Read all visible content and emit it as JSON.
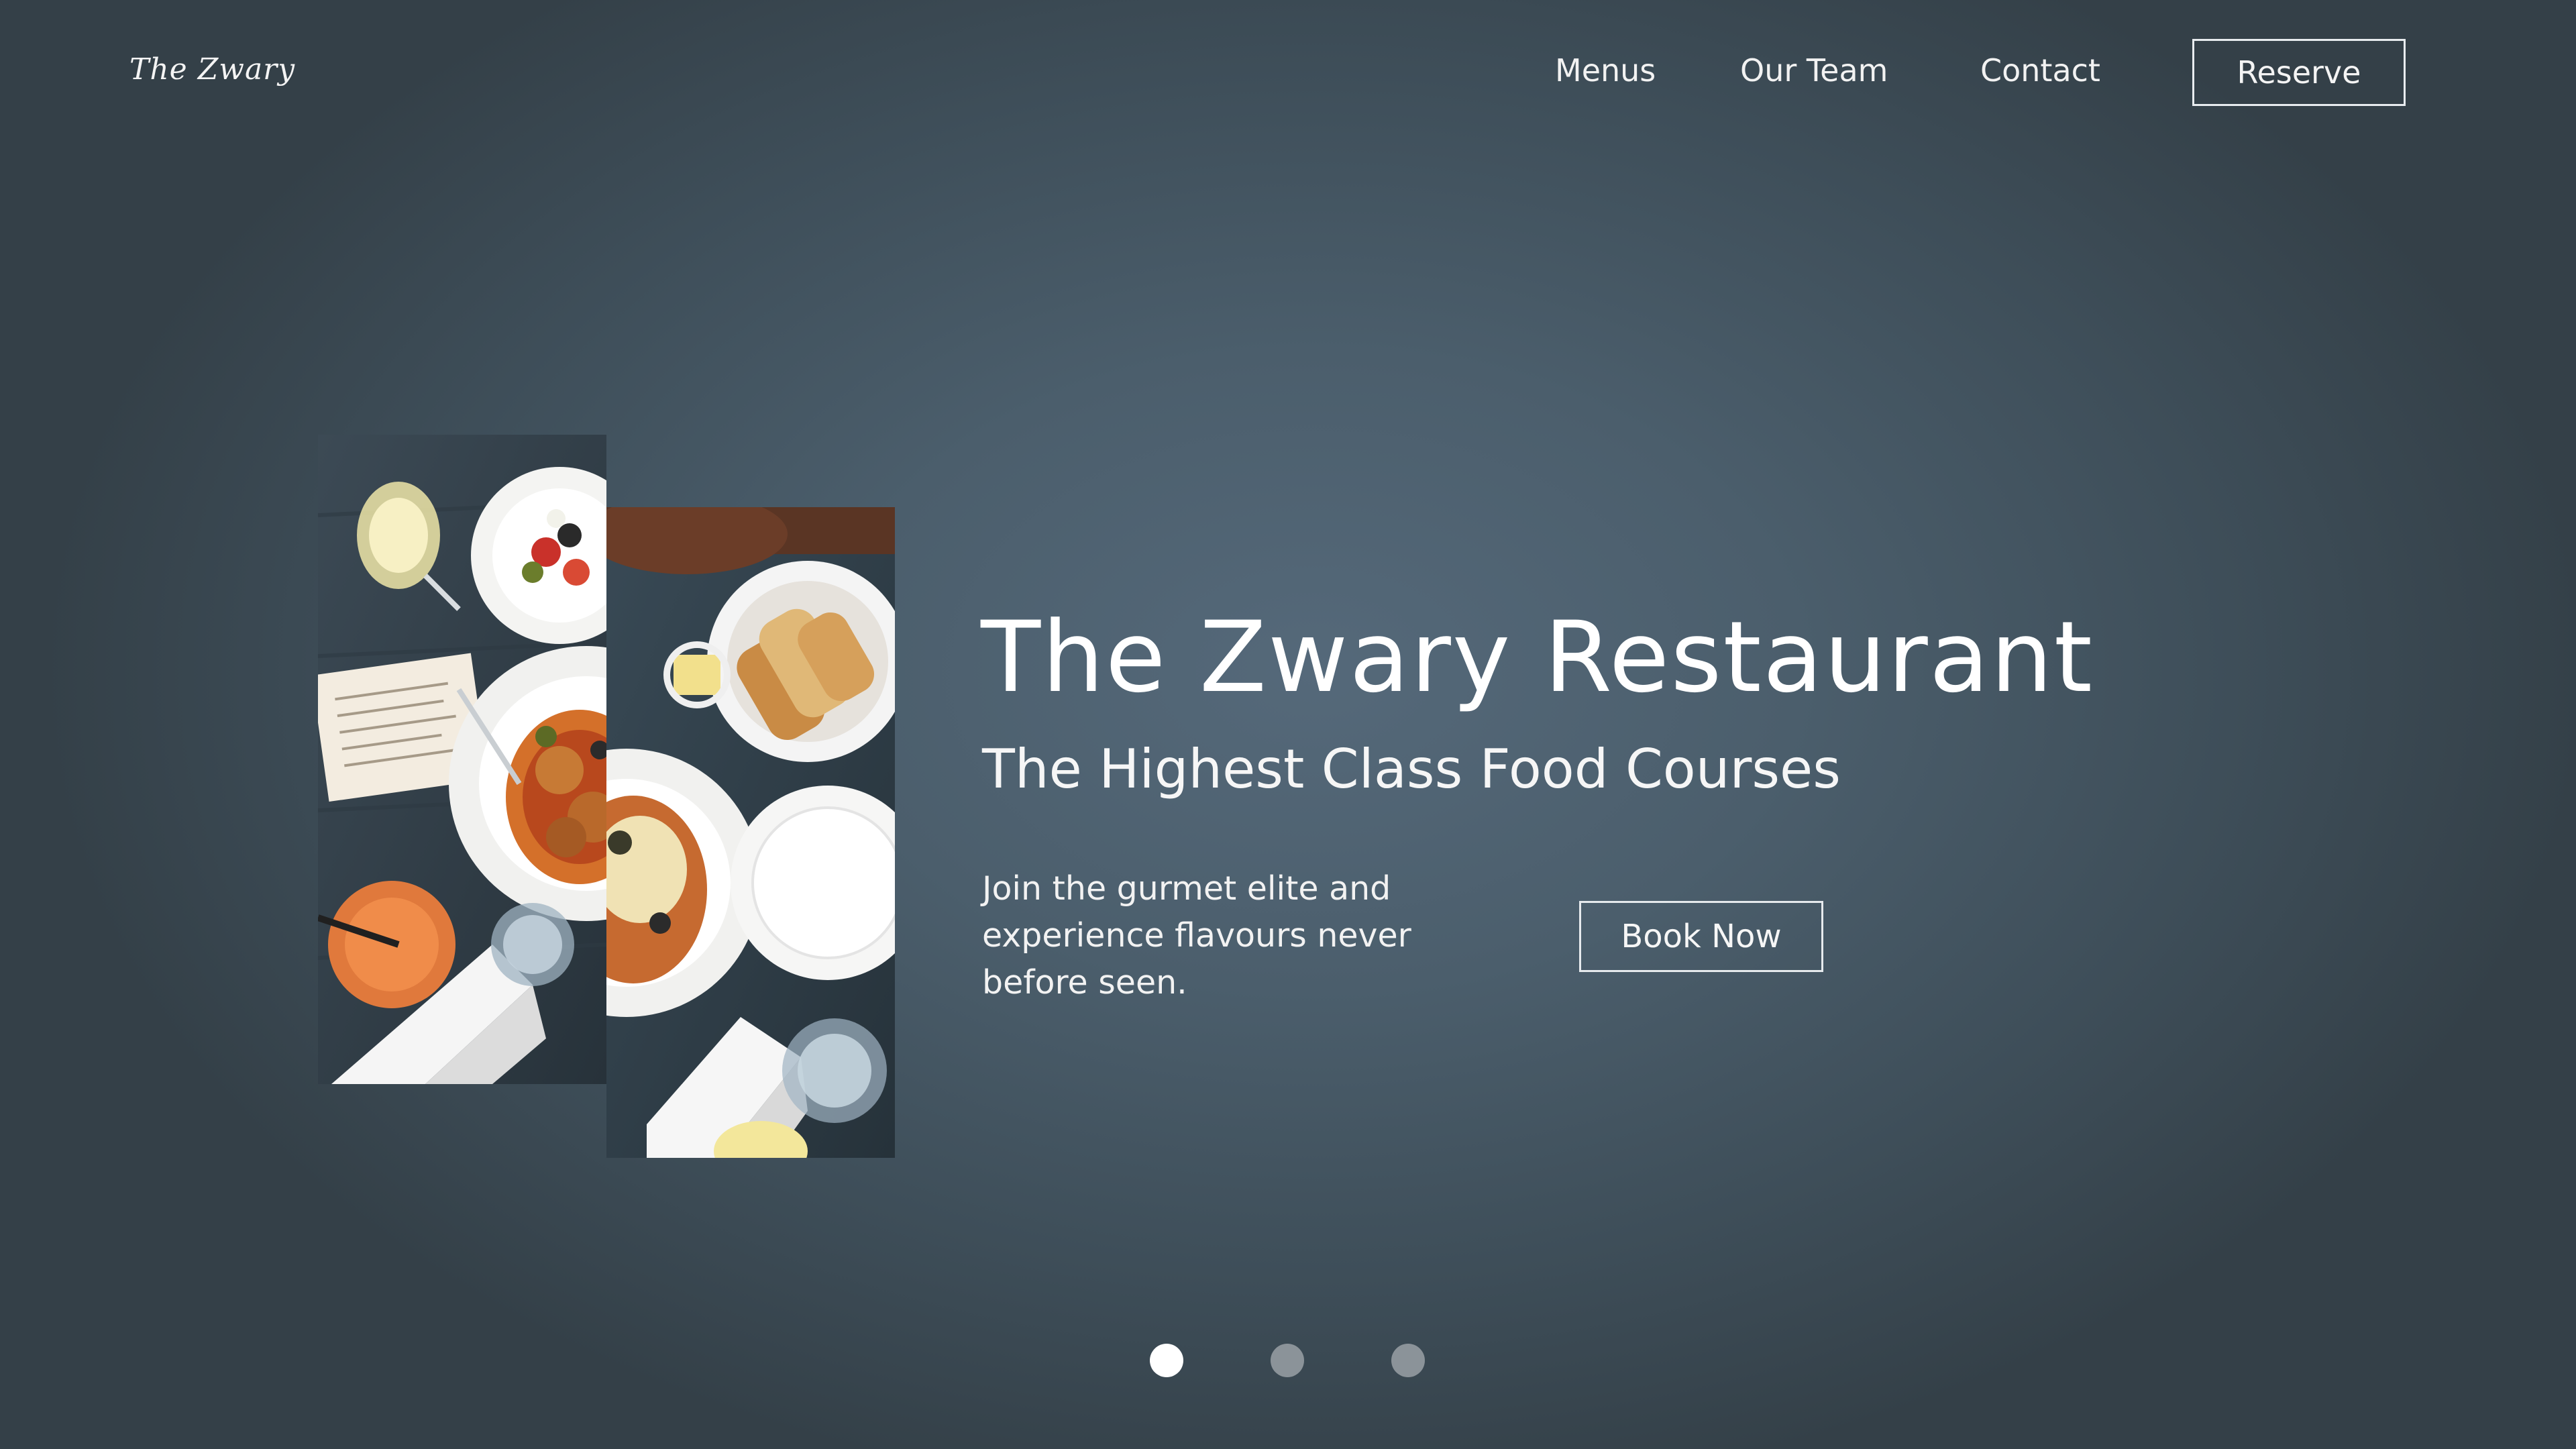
{
  "header": {
    "logo": "The Zwary",
    "nav": {
      "menus": "Menus",
      "our_team": "Our Team",
      "contact": "Contact"
    },
    "reserve_label": "Reserve"
  },
  "hero": {
    "title": "The Zwary Restaurant",
    "subtitle": "The Highest Class Food Courses",
    "description": "Join the gurmet elite and experience flavours never before seen.",
    "cta_label": "Book Now"
  },
  "carousel": {
    "slide_count": 3,
    "active_index": 0
  },
  "colors": {
    "background_center": "#55697a",
    "background_edge": "#344048",
    "text": "#ffffff",
    "dot_active": "#ffffff",
    "dot_inactive": "#8b9399"
  },
  "icons": {
    "logo": "script-wordmark",
    "photos": [
      "food-table-photo-left",
      "food-table-photo-right"
    ]
  }
}
